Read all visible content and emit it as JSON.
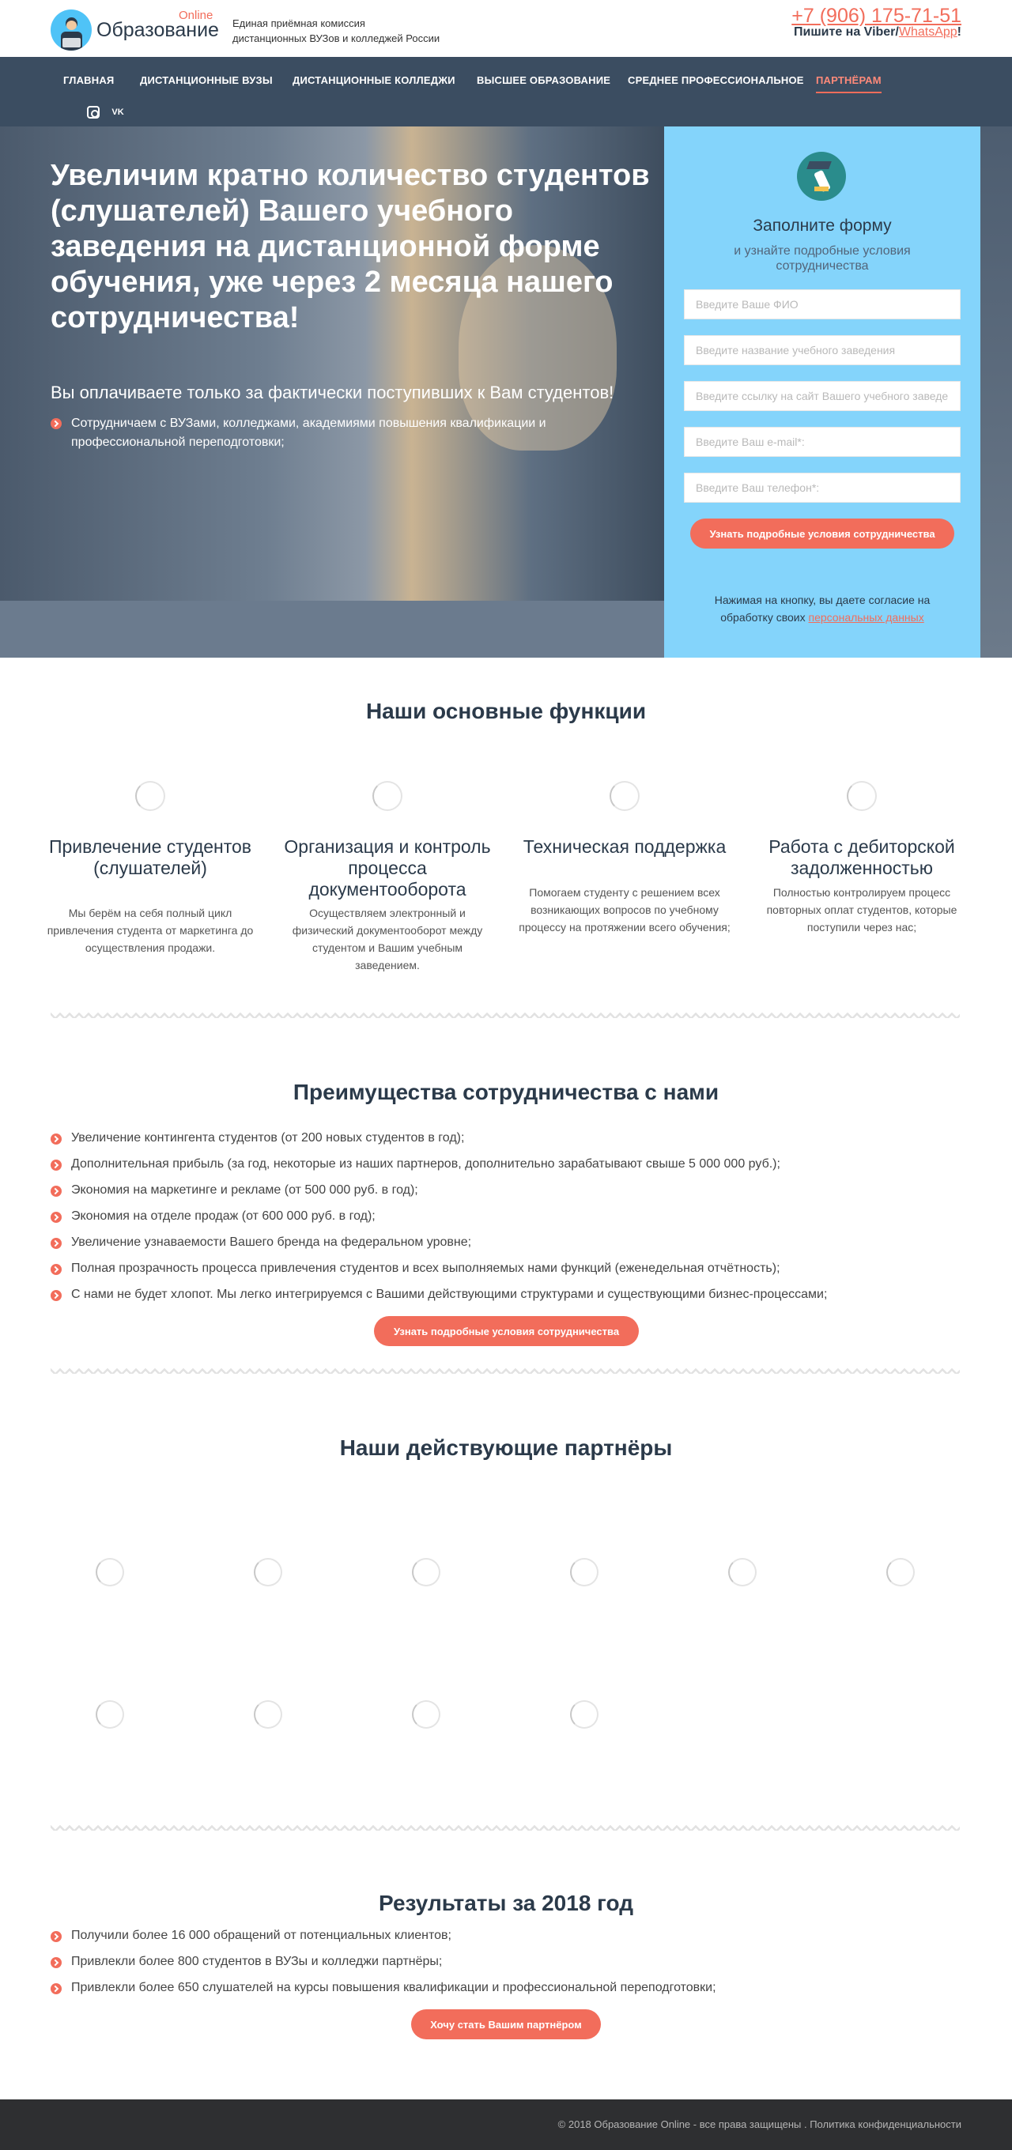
{
  "header": {
    "brand_online": "Online",
    "brand_name": "Образование",
    "tagline_line1": "Единая приёмная комиссия",
    "tagline_line2": "дистанционных ВУЗов и колледжей России",
    "phone": "+7 (906) 175-71-51",
    "messenger_prefix": "Пишите на Viber/",
    "messenger_link": "WhatsApp",
    "messenger_suffix": "!"
  },
  "nav": {
    "items": [
      {
        "label": "ГЛАВНАЯ"
      },
      {
        "label": "ДИСТАНЦИОННЫЕ ВУЗЫ"
      },
      {
        "label": "ДИСТАНЦИОННЫЕ КОЛЛЕДЖИ"
      },
      {
        "label": "ВЫСШЕЕ ОБРАЗОВАНИЕ"
      },
      {
        "label": "СРЕДНЕЕ ПРОФЕССИОНАЛЬНОЕ"
      },
      {
        "label": "ПАРТНЁРАМ"
      }
    ],
    "active": "ПАРТНЁРАМ",
    "social_icons": [
      "instagram-icon",
      "vk-icon"
    ],
    "vk_glyph": "VK"
  },
  "hero": {
    "title": "Увеличим кратно количество студентов (слушателей) Вашего учебного заведения на дистанционной форме обучения, уже через 2 месяца нашего сотрудничества!",
    "subtitle": "Вы оплачиваете только за фактически поступивших к Вам студентов!",
    "point": "Сотрудничаем с ВУЗами, колледжами, академиями повышения квалификации и профессиональной переподготовки;"
  },
  "form": {
    "title": "Заполните форму",
    "subtitle": "и узнайте подробные условия сотрудничества",
    "fields": [
      {
        "placeholder": "Введите Ваше ФИО",
        "value": ""
      },
      {
        "placeholder": "Введите название учебного заведения",
        "value": ""
      },
      {
        "placeholder": "Введите ссылку на сайт Вашего учебного заведения",
        "value": ""
      },
      {
        "placeholder": "Введите Ваш e-mail*:",
        "value": ""
      },
      {
        "placeholder": "Введите Ваш телефон*:",
        "value": ""
      }
    ],
    "submit_label": "Узнать подробные условия сотрудничества",
    "consent_text": "Нажимая на кнопку, вы даете согласие на обработку своих ",
    "consent_link": "персональных данных"
  },
  "functions": {
    "title": "Наши основные функции",
    "items": [
      {
        "title": "Привлечение студентов (слушателей)",
        "text": "Мы берём на себя полный цикл привлечения студента от маркетинга до осуществления продажи."
      },
      {
        "title": "Организация и контроль процесса документооборота",
        "text": "Осуществляем электронный и физический документооборот между студентом и Вашим учебным заведением."
      },
      {
        "title": "Техническая поддержка",
        "text": "Помогаем студенту с решением всех возникающих вопросов по учебному процессу на протяжении всего обучения;"
      },
      {
        "title": "Работа с дебиторской задолженностью",
        "text": "Полностью контролируем процесс повторных оплат студентов, которые поступили через нас;"
      }
    ]
  },
  "advantages": {
    "title": "Преимущества сотрудничества с нами",
    "items": [
      "Увеличение контингента студентов (от 200 новых студентов в год);",
      "Дополнительная прибыль (за год, некоторые из наших партнеров, дополнительно зарабатывают свыше 5 000 000 руб.);",
      "Экономия на маркетинге и рекламе (от 500 000 руб. в год);",
      "Экономия на отделе продаж (от 600 000 руб. в год);",
      "Увеличение узнаваемости Вашего бренда на федеральном уровне;",
      "Полная прозрачность процесса привлечения студентов и всех выполняемых нами функций (еженедельная отчётность);",
      "С нами не будет хлопот. Мы легко интегрируемся с Вашими действующими структурами и существующими бизнес-процессами;"
    ],
    "button_label": "Узнать подробные условия сотрудничества"
  },
  "partners": {
    "title": "Наши действующие партнёры"
  },
  "results": {
    "title": "Результаты за 2018 год",
    "items": [
      "Получили более 16 000 обращений от потенциальных клиентов;",
      "Привлекли более 800 студентов в ВУЗы и колледжи партнёры;",
      "Привлекли более 650 слушателей на курсы повышения квалификации и профессиональной переподготовки;"
    ],
    "button_label": "Хочу стать Вашим партнёром"
  },
  "footer": {
    "copyright": "© 2018 Образование Online - все права защищены . Политика конфиденциальности"
  },
  "colors": {
    "accent": "#f26d5b",
    "nav_bg": "#3b4d61",
    "form_bg": "#84d4fb",
    "heading": "#2b3a4a",
    "footer_bg": "#2e2f31"
  }
}
